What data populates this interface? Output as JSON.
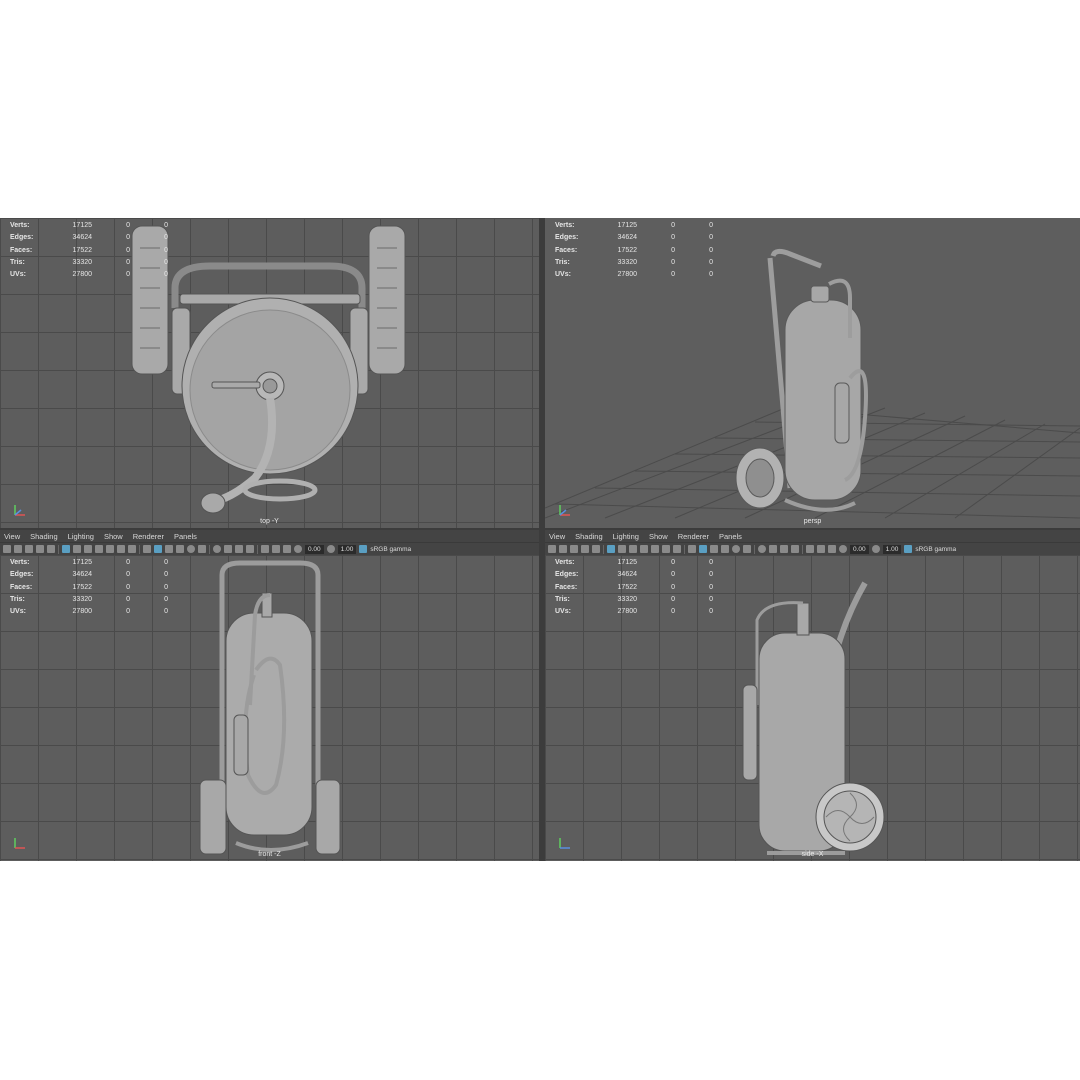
{
  "stats": {
    "labels": [
      "Verts:",
      "Edges:",
      "Faces:",
      "Tris:",
      "UVs:"
    ],
    "values": [
      "17125",
      "34624",
      "17522",
      "33320",
      "27800"
    ],
    "zeros": [
      "0",
      "0"
    ]
  },
  "menus": [
    "View",
    "Shading",
    "Lighting",
    "Show",
    "Renderer",
    "Panels"
  ],
  "toolbar": {
    "exposure": "0.00",
    "gamma": "1.00",
    "color_space": "sRGB gamma"
  },
  "viewports": {
    "top": "top -Y",
    "persp": "persp",
    "front": "front -Z",
    "side": "side -X"
  },
  "colors": {
    "viewport_bg": "#5d5d5d",
    "grid": "#4a4a4a",
    "model": "#a8a8a8",
    "toolbar_bg": "#444444",
    "accent": "#5a9fc2"
  },
  "icons": [
    "camera-icon",
    "grid-icon",
    "wireframe-icon",
    "shaded-icon",
    "light-icon",
    "isolate-icon",
    "xray-icon",
    "color-space-icon",
    "axis-gizmo-icon"
  ]
}
